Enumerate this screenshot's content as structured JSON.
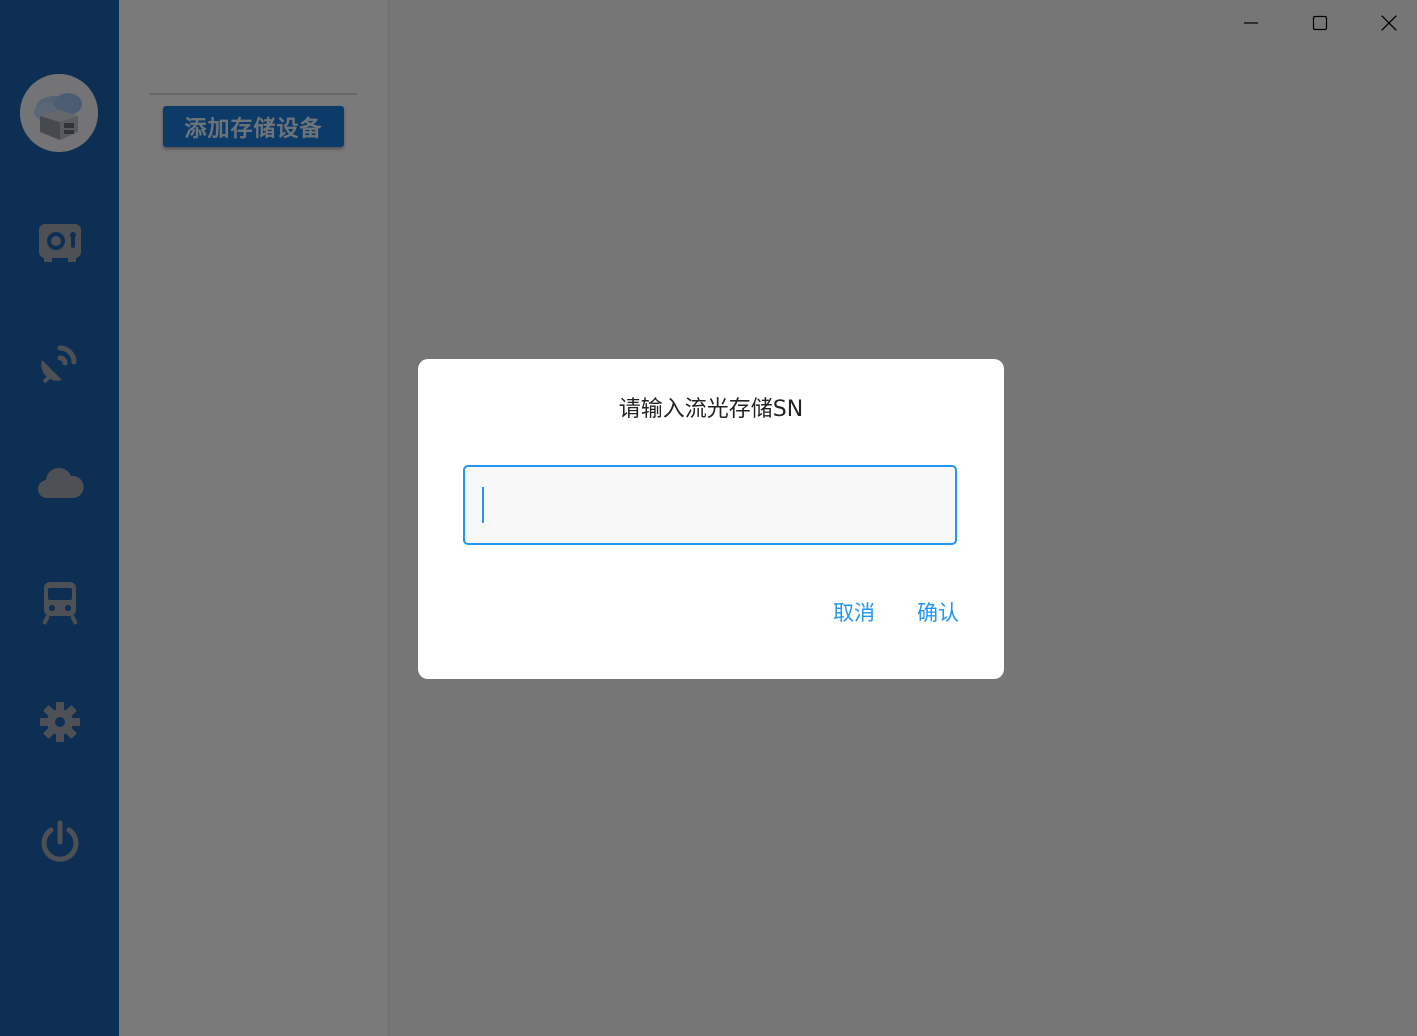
{
  "sidebar": {
    "avatar_icon": "cloud-storage-avatar",
    "items": [
      {
        "name": "safe-icon"
      },
      {
        "name": "satellite-dish-icon"
      },
      {
        "name": "cloud-icon"
      },
      {
        "name": "train-icon"
      },
      {
        "name": "gear-icon"
      },
      {
        "name": "power-icon"
      }
    ]
  },
  "panel": {
    "add_button_label": "添加存储设备"
  },
  "window_controls": {
    "minimize": "minimize-icon",
    "maximize": "maximize-icon",
    "close": "close-icon"
  },
  "dialog": {
    "title": "请输入流光存储SN",
    "input_value": "",
    "cancel_label": "取消",
    "confirm_label": "确认"
  },
  "colors": {
    "sidebar": "#1a5fa9",
    "button": "#1976d2",
    "accent": "#2196f3",
    "overlay": "rgba(0,0,0,0.5)"
  }
}
